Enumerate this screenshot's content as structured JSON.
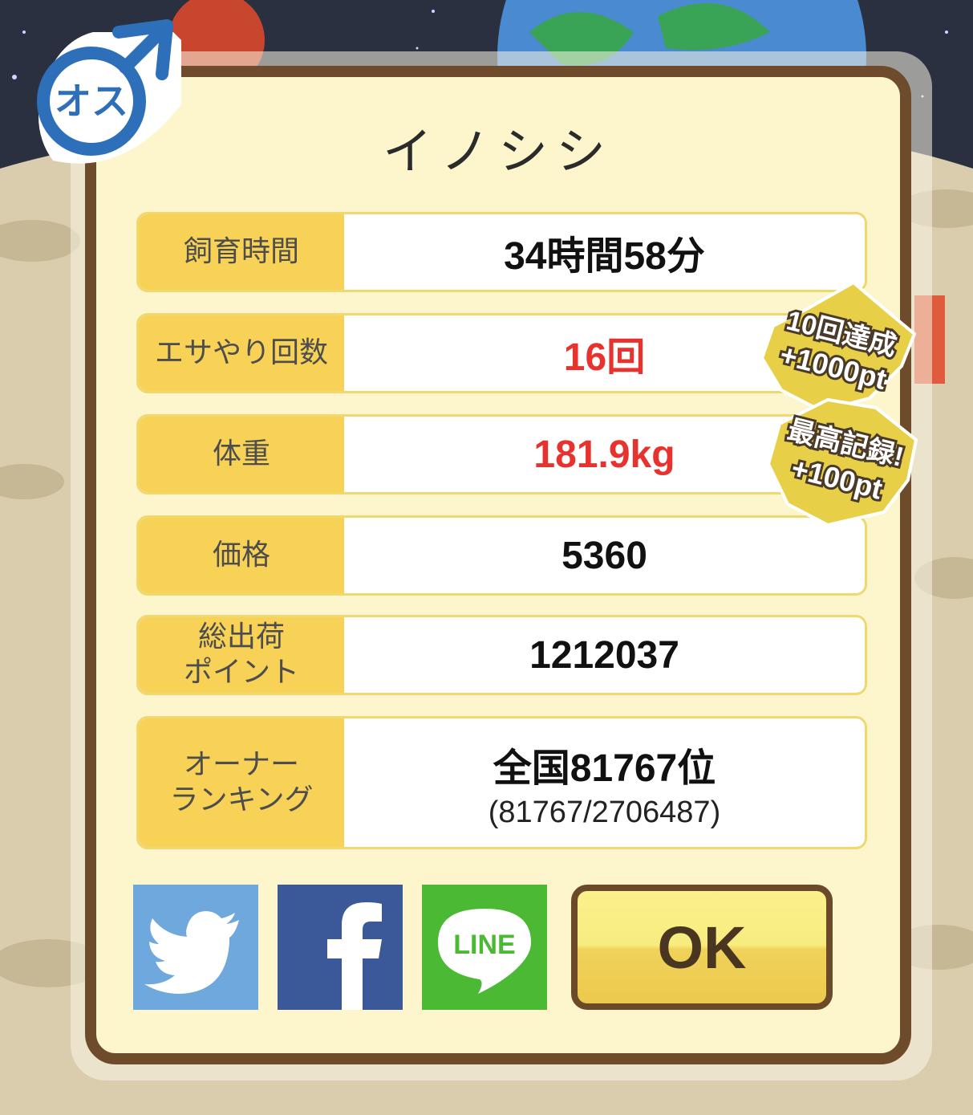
{
  "gender": {
    "label": "オス"
  },
  "animal": {
    "name": "イノシシ"
  },
  "stats": [
    {
      "label": "飼育時間",
      "value": "34時間58分"
    },
    {
      "label": "エサやり回数",
      "value": "16回"
    },
    {
      "label": "体重",
      "value": "181.9kg"
    },
    {
      "label": "価格",
      "value": "5360"
    },
    {
      "label": "総出荷\nポイント",
      "value": "1212037"
    },
    {
      "label": "オーナー\nランキング",
      "value": "全国81767位",
      "sub": "(81767/2706487)"
    }
  ],
  "badges": [
    {
      "line1": "10回達成",
      "line2": "+1000pt"
    },
    {
      "line1": "最高記録!",
      "line2": "+100pt"
    }
  ],
  "share": {
    "twitter": "twitter-icon",
    "facebook": "facebook-icon",
    "line": {
      "icon": "line-icon",
      "text": "LINE"
    }
  },
  "ok_button": {
    "label": "OK"
  },
  "colors": {
    "label_bg": "#f7d257",
    "panel_border": "#6e4c2b",
    "highlight": "#e8322d",
    "twitter": "#6fa8dc",
    "facebook": "#3b5998",
    "line": "#4cb934"
  }
}
